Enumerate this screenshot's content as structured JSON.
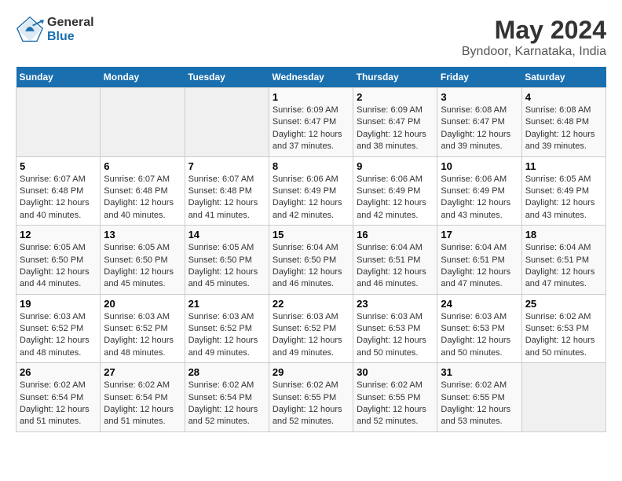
{
  "header": {
    "logo_line1": "General",
    "logo_line2": "Blue",
    "title": "May 2024",
    "subtitle": "Byndoor, Karnataka, India"
  },
  "weekdays": [
    "Sunday",
    "Monday",
    "Tuesday",
    "Wednesday",
    "Thursday",
    "Friday",
    "Saturday"
  ],
  "weeks": [
    [
      {
        "day": "",
        "info": ""
      },
      {
        "day": "",
        "info": ""
      },
      {
        "day": "",
        "info": ""
      },
      {
        "day": "1",
        "info": "Sunrise: 6:09 AM\nSunset: 6:47 PM\nDaylight: 12 hours and 37 minutes."
      },
      {
        "day": "2",
        "info": "Sunrise: 6:09 AM\nSunset: 6:47 PM\nDaylight: 12 hours and 38 minutes."
      },
      {
        "day": "3",
        "info": "Sunrise: 6:08 AM\nSunset: 6:47 PM\nDaylight: 12 hours and 39 minutes."
      },
      {
        "day": "4",
        "info": "Sunrise: 6:08 AM\nSunset: 6:48 PM\nDaylight: 12 hours and 39 minutes."
      }
    ],
    [
      {
        "day": "5",
        "info": "Sunrise: 6:07 AM\nSunset: 6:48 PM\nDaylight: 12 hours and 40 minutes."
      },
      {
        "day": "6",
        "info": "Sunrise: 6:07 AM\nSunset: 6:48 PM\nDaylight: 12 hours and 40 minutes."
      },
      {
        "day": "7",
        "info": "Sunrise: 6:07 AM\nSunset: 6:48 PM\nDaylight: 12 hours and 41 minutes."
      },
      {
        "day": "8",
        "info": "Sunrise: 6:06 AM\nSunset: 6:49 PM\nDaylight: 12 hours and 42 minutes."
      },
      {
        "day": "9",
        "info": "Sunrise: 6:06 AM\nSunset: 6:49 PM\nDaylight: 12 hours and 42 minutes."
      },
      {
        "day": "10",
        "info": "Sunrise: 6:06 AM\nSunset: 6:49 PM\nDaylight: 12 hours and 43 minutes."
      },
      {
        "day": "11",
        "info": "Sunrise: 6:05 AM\nSunset: 6:49 PM\nDaylight: 12 hours and 43 minutes."
      }
    ],
    [
      {
        "day": "12",
        "info": "Sunrise: 6:05 AM\nSunset: 6:50 PM\nDaylight: 12 hours and 44 minutes."
      },
      {
        "day": "13",
        "info": "Sunrise: 6:05 AM\nSunset: 6:50 PM\nDaylight: 12 hours and 45 minutes."
      },
      {
        "day": "14",
        "info": "Sunrise: 6:05 AM\nSunset: 6:50 PM\nDaylight: 12 hours and 45 minutes."
      },
      {
        "day": "15",
        "info": "Sunrise: 6:04 AM\nSunset: 6:50 PM\nDaylight: 12 hours and 46 minutes."
      },
      {
        "day": "16",
        "info": "Sunrise: 6:04 AM\nSunset: 6:51 PM\nDaylight: 12 hours and 46 minutes."
      },
      {
        "day": "17",
        "info": "Sunrise: 6:04 AM\nSunset: 6:51 PM\nDaylight: 12 hours and 47 minutes."
      },
      {
        "day": "18",
        "info": "Sunrise: 6:04 AM\nSunset: 6:51 PM\nDaylight: 12 hours and 47 minutes."
      }
    ],
    [
      {
        "day": "19",
        "info": "Sunrise: 6:03 AM\nSunset: 6:52 PM\nDaylight: 12 hours and 48 minutes."
      },
      {
        "day": "20",
        "info": "Sunrise: 6:03 AM\nSunset: 6:52 PM\nDaylight: 12 hours and 48 minutes."
      },
      {
        "day": "21",
        "info": "Sunrise: 6:03 AM\nSunset: 6:52 PM\nDaylight: 12 hours and 49 minutes."
      },
      {
        "day": "22",
        "info": "Sunrise: 6:03 AM\nSunset: 6:52 PM\nDaylight: 12 hours and 49 minutes."
      },
      {
        "day": "23",
        "info": "Sunrise: 6:03 AM\nSunset: 6:53 PM\nDaylight: 12 hours and 50 minutes."
      },
      {
        "day": "24",
        "info": "Sunrise: 6:03 AM\nSunset: 6:53 PM\nDaylight: 12 hours and 50 minutes."
      },
      {
        "day": "25",
        "info": "Sunrise: 6:02 AM\nSunset: 6:53 PM\nDaylight: 12 hours and 50 minutes."
      }
    ],
    [
      {
        "day": "26",
        "info": "Sunrise: 6:02 AM\nSunset: 6:54 PM\nDaylight: 12 hours and 51 minutes."
      },
      {
        "day": "27",
        "info": "Sunrise: 6:02 AM\nSunset: 6:54 PM\nDaylight: 12 hours and 51 minutes."
      },
      {
        "day": "28",
        "info": "Sunrise: 6:02 AM\nSunset: 6:54 PM\nDaylight: 12 hours and 52 minutes."
      },
      {
        "day": "29",
        "info": "Sunrise: 6:02 AM\nSunset: 6:55 PM\nDaylight: 12 hours and 52 minutes."
      },
      {
        "day": "30",
        "info": "Sunrise: 6:02 AM\nSunset: 6:55 PM\nDaylight: 12 hours and 52 minutes."
      },
      {
        "day": "31",
        "info": "Sunrise: 6:02 AM\nSunset: 6:55 PM\nDaylight: 12 hours and 53 minutes."
      },
      {
        "day": "",
        "info": ""
      }
    ]
  ]
}
